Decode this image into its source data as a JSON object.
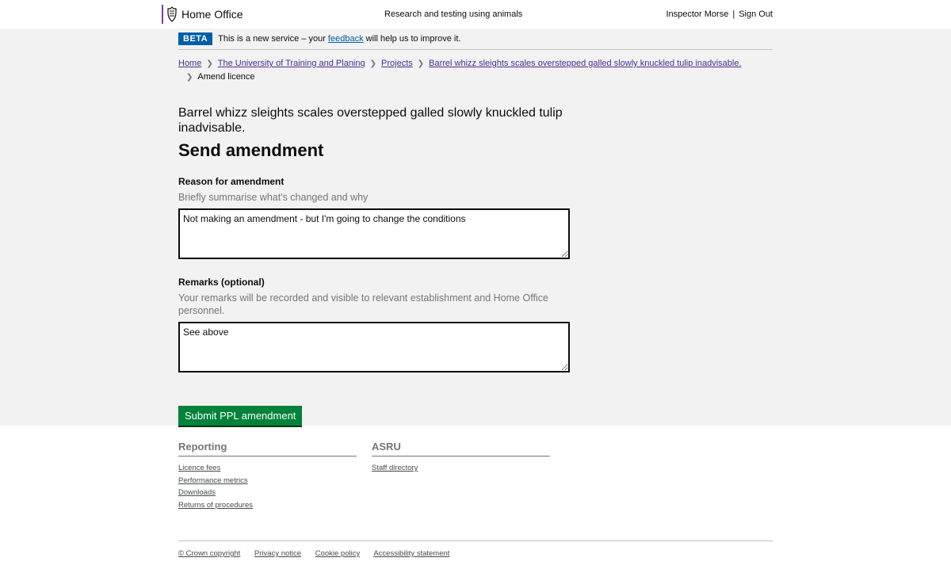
{
  "header": {
    "brand": "Home Office",
    "service_name": "Research and testing using animals",
    "user_name": "Inspector Morse",
    "separator": "|",
    "sign_out": "Sign Out"
  },
  "beta": {
    "tag": "BETA",
    "text_before": "This is a new service – your",
    "link": "feedback",
    "text_after": "will help us to improve it."
  },
  "breadcrumbs": {
    "items": [
      "Home",
      "The University of Training and Planing",
      "Projects",
      "Barrel whizz sleights scales overstepped galled slowly knuckled tulip inadvisable."
    ],
    "current": "Amend licence",
    "chevron": ">"
  },
  "page": {
    "project_title": "Barrel whizz sleights scales overstepped galled slowly knuckled tulip inadvisable.",
    "title": "Send amendment"
  },
  "form": {
    "reason": {
      "label": "Reason for amendment",
      "hint": "Briefly summarise what's changed and why",
      "value": "Not making an amendment - but I'm going to change the conditions"
    },
    "remarks": {
      "label": "Remarks (optional)",
      "hint": "Your remarks will be recorded and visible to relevant establishment and Home Office personnel.",
      "value": "See above"
    },
    "submit_label": "Submit PPL amendment",
    "submit_color": "#00823b"
  },
  "footer": {
    "reporting": {
      "heading": "Reporting",
      "links": [
        "Licence fees",
        "Performance metrics",
        "Downloads",
        "Returns of procedures"
      ]
    },
    "asru": {
      "heading": "ASRU",
      "links": [
        "Staff directory"
      ]
    },
    "bottom_links": [
      "© Crown copyright",
      "Privacy notice",
      "Cookie policy",
      "Accessibility statement"
    ]
  }
}
